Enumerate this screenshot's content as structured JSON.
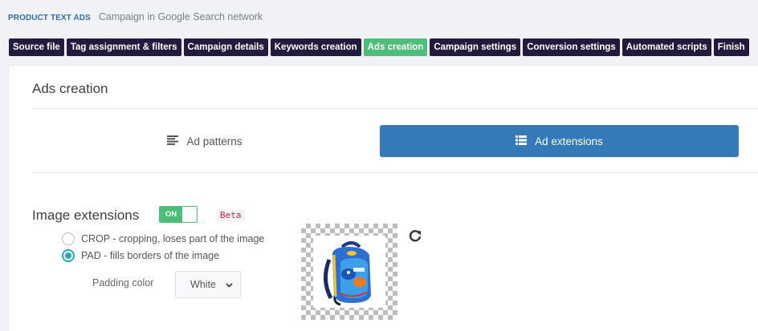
{
  "header": {
    "brand": "PRODUCT TEXT ADS",
    "subtitle": "Campaign in Google Search network"
  },
  "tabs": [
    {
      "label": "Source file",
      "active": false
    },
    {
      "label": "Tag assignment & filters",
      "active": false
    },
    {
      "label": "Campaign details",
      "active": false
    },
    {
      "label": "Keywords creation",
      "active": false
    },
    {
      "label": "Ads creation",
      "active": true
    },
    {
      "label": "Campaign settings",
      "active": false
    },
    {
      "label": "Conversion settings",
      "active": false
    },
    {
      "label": "Automated scripts",
      "active": false
    },
    {
      "label": "Finish",
      "active": false
    }
  ],
  "panel": {
    "title": "Ads creation",
    "subtabs": {
      "patterns": {
        "label": "Ad patterns",
        "icon": "align-left-icon"
      },
      "extensions": {
        "label": "Ad extensions",
        "icon": "list-icon",
        "active": true
      }
    }
  },
  "image_extensions": {
    "title": "Image extensions",
    "toggle_label": "ON",
    "toggle_state": true,
    "beta_label": "Beta",
    "options": [
      {
        "label": "CROP - cropping, loses part of the image",
        "checked": false
      },
      {
        "label": "PAD - fills borders of the image",
        "checked": true
      }
    ],
    "padding_color_label": "Padding color",
    "padding_color_value": "White",
    "preview_icon": "backpack-product-image",
    "refresh_icon": "refresh-icon"
  },
  "colors": {
    "tab_bg": "#231a3d",
    "tab_active": "#4cbe79",
    "primary_button": "#347ab9",
    "radio_checked": "#27a9b7",
    "beta_text": "#c7254e"
  }
}
